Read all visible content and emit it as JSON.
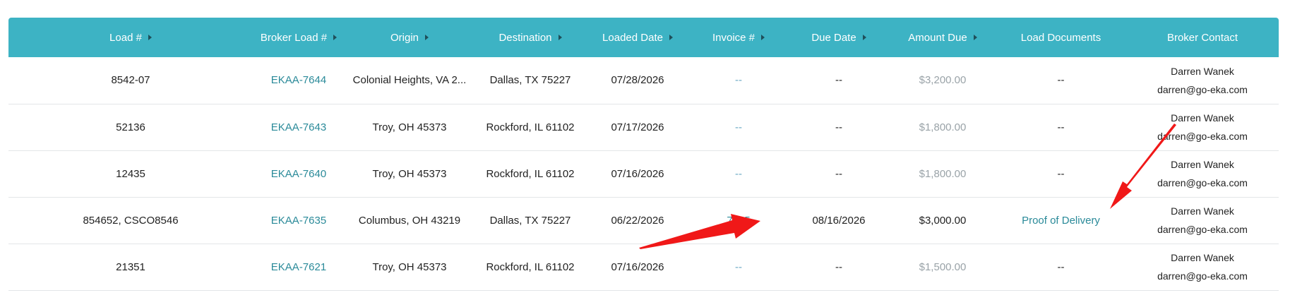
{
  "columns": [
    {
      "key": "load",
      "label": "Load #",
      "sortable": true
    },
    {
      "key": "broker_load",
      "label": "Broker Load #",
      "sortable": true
    },
    {
      "key": "origin",
      "label": "Origin",
      "sortable": true
    },
    {
      "key": "destination",
      "label": "Destination",
      "sortable": true
    },
    {
      "key": "loaded_date",
      "label": "Loaded Date",
      "sortable": true
    },
    {
      "key": "invoice",
      "label": "Invoice #",
      "sortable": true
    },
    {
      "key": "due_date",
      "label": "Due Date",
      "sortable": true
    },
    {
      "key": "amount_due",
      "label": "Amount Due",
      "sortable": true
    },
    {
      "key": "load_documents",
      "label": "Load Documents",
      "sortable": false
    },
    {
      "key": "broker_contact",
      "label": "Broker Contact",
      "sortable": false
    }
  ],
  "rows": [
    {
      "load": "8542-07",
      "broker_load": "EKAA-7644",
      "origin": "Colonial Heights, VA 2...",
      "destination": "Dallas, TX 75227",
      "loaded_date": "07/28/2026",
      "invoice": "--",
      "due_date": "--",
      "amount_due": "$3,200.00",
      "load_documents": "--",
      "contact_name": "Darren Wanek",
      "contact_email": "darren@go-eka.com"
    },
    {
      "load": "52136",
      "broker_load": "EKAA-7643",
      "origin": "Troy, OH 45373",
      "destination": "Rockford, IL 61102",
      "loaded_date": "07/17/2026",
      "invoice": "--",
      "due_date": "--",
      "amount_due": "$1,800.00",
      "load_documents": "--",
      "contact_name": "Darren Wanek",
      "contact_email": "darren@go-eka.com"
    },
    {
      "load": "12435",
      "broker_load": "EKAA-7640",
      "origin": "Troy, OH 45373",
      "destination": "Rockford, IL 61102",
      "loaded_date": "07/16/2026",
      "invoice": "--",
      "due_date": "--",
      "amount_due": "$1,800.00",
      "load_documents": "--",
      "contact_name": "Darren Wanek",
      "contact_email": "darren@go-eka.com"
    },
    {
      "load": "854652, CSCO8546",
      "broker_load": "EKAA-7635",
      "origin": "Columbus, OH 43219",
      "destination": "Dallas, TX 75227",
      "loaded_date": "06/22/2026",
      "invoice": "7635",
      "due_date": "08/16/2026",
      "amount_due": "$3,000.00",
      "load_documents": "Proof of Delivery",
      "contact_name": "Darren Wanek",
      "contact_email": "darren@go-eka.com"
    },
    {
      "load": "21351",
      "broker_load": "EKAA-7621",
      "origin": "Troy, OH 45373",
      "destination": "Rockford, IL 61102",
      "loaded_date": "07/16/2026",
      "invoice": "--",
      "due_date": "--",
      "amount_due": "$1,500.00",
      "load_documents": "--",
      "contact_name": "Darren Wanek",
      "contact_email": "darren@go-eka.com"
    }
  ],
  "colors": {
    "header_bg": "#3db3c4",
    "link": "#2a8a99",
    "muted_link": "#6aa9c4",
    "muted_amount": "#9aa3a8",
    "annotation_arrow": "#f01818"
  },
  "icons": {
    "sort": "caret-right-icon",
    "annotation": "red-arrow-icon"
  }
}
